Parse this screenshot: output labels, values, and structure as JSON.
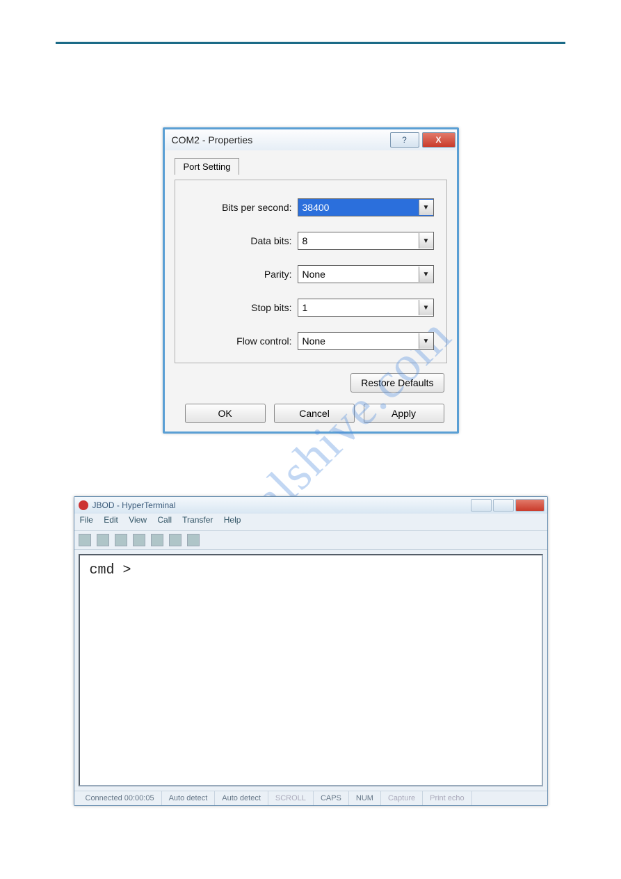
{
  "watermark": "manualshive.com",
  "dialog1": {
    "title": "COM2 - Properties",
    "tab": "Port Setting",
    "fields": {
      "bps_label": "Bits per second:",
      "bps_value": "38400",
      "data_label": "Data bits:",
      "data_value": "8",
      "parity_label": "Parity:",
      "parity_value": "None",
      "stop_label": "Stop bits:",
      "stop_value": "1",
      "flow_label": "Flow control:",
      "flow_value": "None"
    },
    "restore": "Restore Defaults",
    "ok": "OK",
    "cancel": "Cancel",
    "apply": "Apply",
    "help_glyph": "?",
    "close_glyph": "X"
  },
  "dialog2": {
    "title": "JBOD - HyperTerminal",
    "menu": {
      "file": "File",
      "edit": "Edit",
      "view": "View",
      "call": "Call",
      "transfer": "Transfer",
      "help": "Help"
    },
    "terminal_prompt": "cmd >",
    "status": {
      "connected": "Connected 00:00:05",
      "detect1": "Auto detect",
      "detect2": "Auto detect",
      "scroll": "SCROLL",
      "caps": "CAPS",
      "num": "NUM",
      "capture": "Capture",
      "print": "Print echo"
    }
  }
}
